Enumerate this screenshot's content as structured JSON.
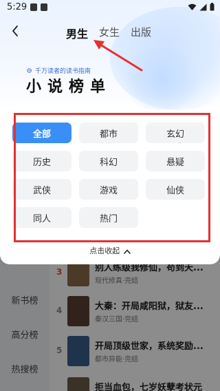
{
  "status": {
    "time": "5:29"
  },
  "header": {
    "tabs": [
      {
        "label": "男生",
        "active": true
      },
      {
        "label": "女生",
        "active": false
      },
      {
        "label": "出版",
        "active": false
      }
    ]
  },
  "hero": {
    "slogan": "千万读者的读书指南",
    "title": "小说榜单"
  },
  "categories": [
    {
      "label": "全部",
      "selected": true
    },
    {
      "label": "都市"
    },
    {
      "label": "玄幻"
    },
    {
      "label": "历史"
    },
    {
      "label": "科幻"
    },
    {
      "label": "悬疑"
    },
    {
      "label": "武侠"
    },
    {
      "label": "游戏"
    },
    {
      "label": "仙侠"
    },
    {
      "label": "同人"
    },
    {
      "label": "热门"
    }
  ],
  "collapse_label": "点击收起",
  "background": {
    "sidebar": [
      "新书榜",
      "高分榜",
      "热搜榜"
    ],
    "books": [
      {
        "rank": "3",
        "title": "别人练级我修仙，苟到天...",
        "meta": "现代修真·完结"
      },
      {
        "rank": "4",
        "title": "大秦：开局咸阳狱，狱友...",
        "meta": "秦汉三国·完结"
      },
      {
        "rank": "5",
        "title": "开局顶级世家，系统奖励...",
        "meta": "都市异能·完结"
      },
      {
        "rank": "",
        "title": "拒当血包，七岁妖孽考状元",
        "meta": ""
      }
    ]
  },
  "colors": {
    "accent": "#3a8ff7",
    "annotation": "#e53030"
  }
}
